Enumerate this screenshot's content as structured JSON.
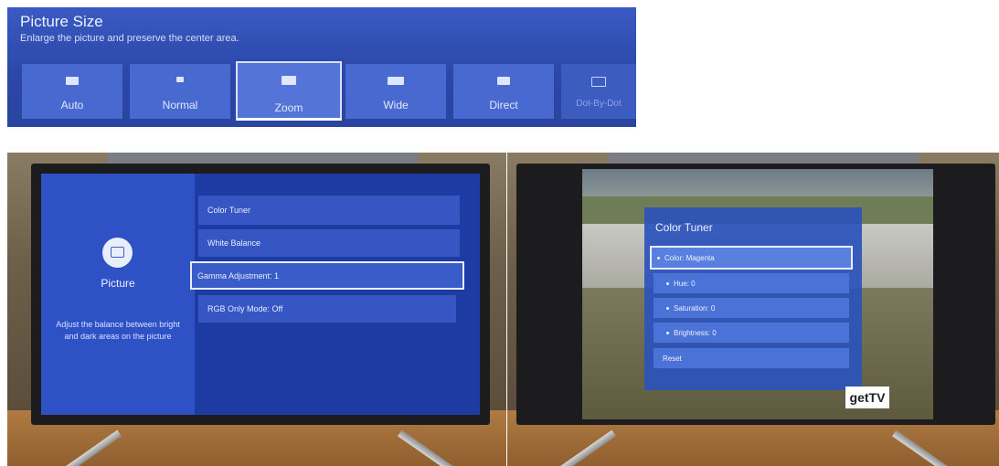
{
  "picture_size": {
    "title": "Picture Size",
    "subtitle": "Enlarge the picture and preserve the center area.",
    "options": [
      {
        "label": "Auto",
        "icon": "screen-full-icon"
      },
      {
        "label": "Normal",
        "icon": "screen-normal-icon"
      },
      {
        "label": "Zoom",
        "icon": "screen-zoom-icon",
        "selected": true
      },
      {
        "label": "Wide",
        "icon": "screen-wide-icon"
      },
      {
        "label": "Direct",
        "icon": "screen-direct-icon"
      },
      {
        "label": "Dot-By-Dot",
        "icon": "screen-dot-by-dot-icon"
      }
    ]
  },
  "picture_menu": {
    "category": "Picture",
    "icon": "picture-icon",
    "description": "Adjust the balance between bright and dark areas on the picture",
    "items": [
      {
        "label": "Color Tuner"
      },
      {
        "label": "White Balance"
      },
      {
        "label": "Gamma Adjustment: 1",
        "selected": true
      },
      {
        "label": "RGB Only Mode: Off"
      }
    ]
  },
  "color_tuner": {
    "title": "Color Tuner",
    "items": [
      {
        "label": "Color: Magenta",
        "selected": true
      },
      {
        "label": "Hue: 0"
      },
      {
        "label": "Saturation: 0"
      },
      {
        "label": "Brightness: 0"
      },
      {
        "label": "Reset"
      }
    ],
    "channel_logo": "getTV"
  },
  "colors": {
    "menu_blue": "#2e51c6",
    "selection_border": "#e9edff"
  }
}
